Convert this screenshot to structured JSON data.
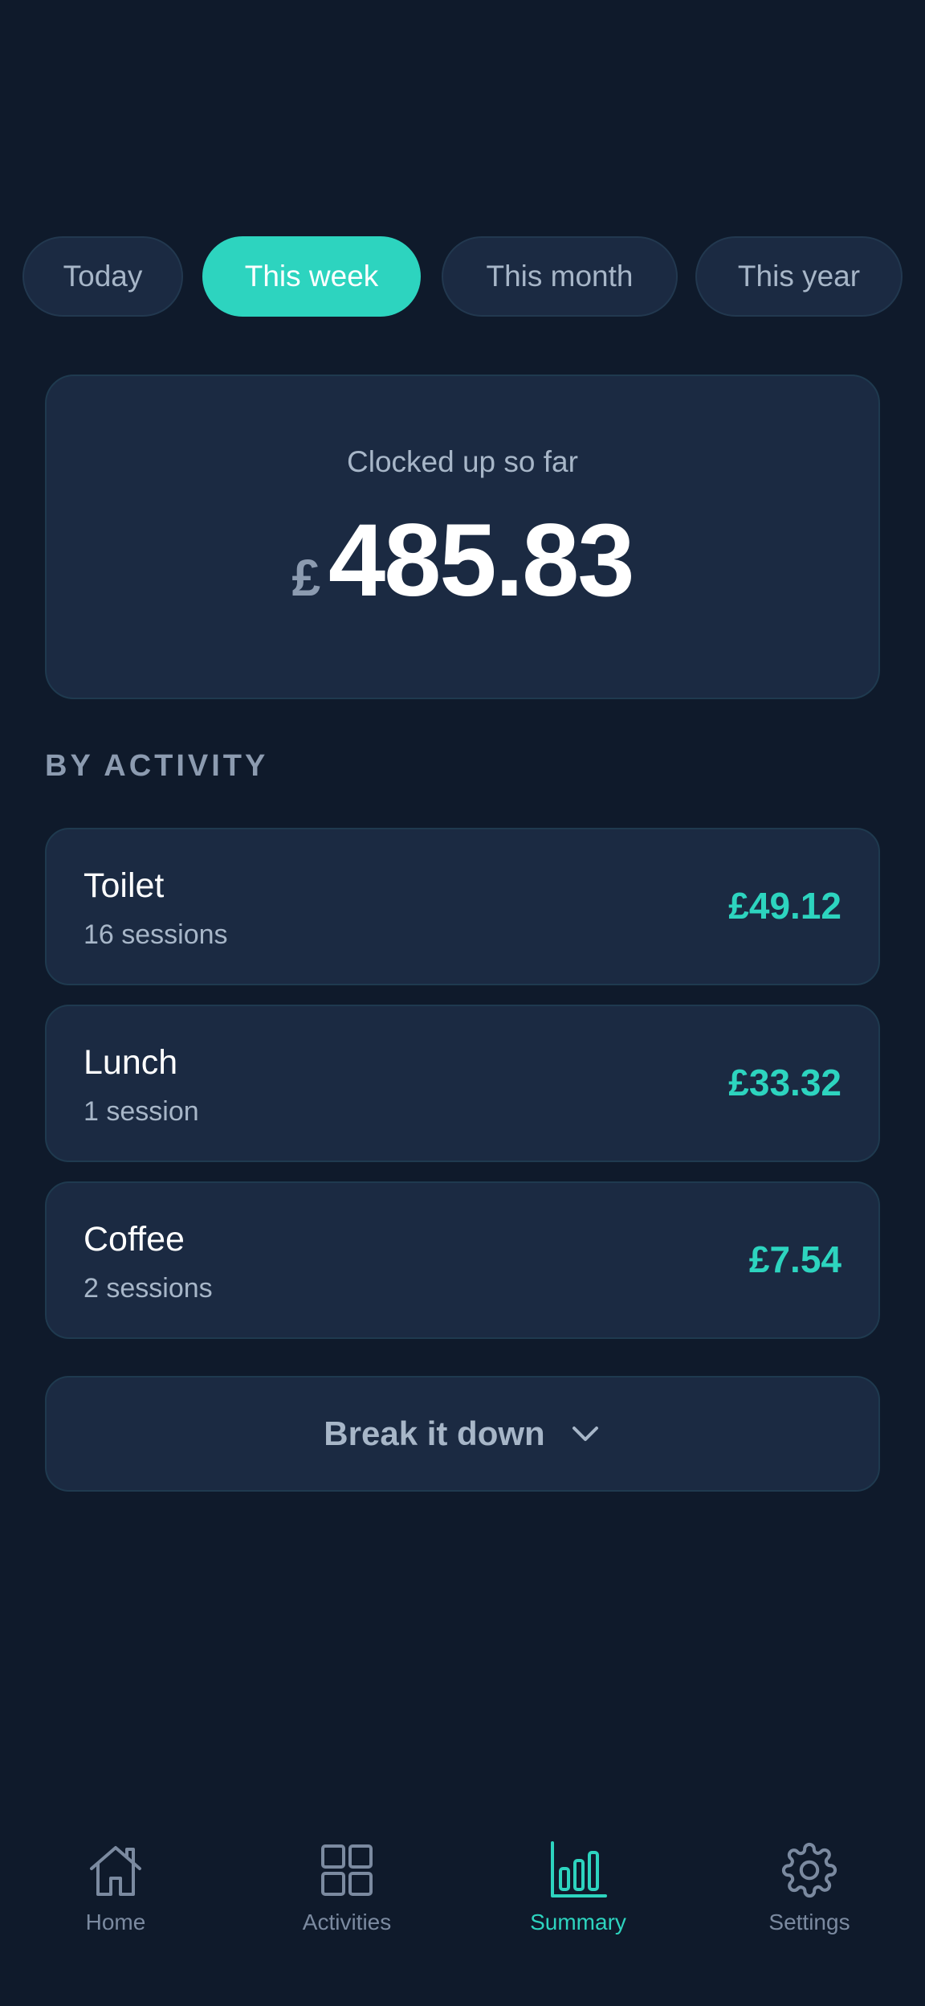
{
  "tabs": [
    {
      "label": "Today",
      "active": false
    },
    {
      "label": "This week",
      "active": true
    },
    {
      "label": "This month",
      "active": false
    },
    {
      "label": "This year",
      "active": false
    }
  ],
  "summary": {
    "label": "Clocked up so far",
    "currency": "£",
    "amount": "485.83"
  },
  "section": {
    "heading": "BY ACTIVITY"
  },
  "activities": [
    {
      "name": "Toilet",
      "sessions": "16 sessions",
      "amount": "£49.12"
    },
    {
      "name": "Lunch",
      "sessions": "1 session",
      "amount": "£33.32"
    },
    {
      "name": "Coffee",
      "sessions": "2 sessions",
      "amount": "£7.54"
    }
  ],
  "breakdown": {
    "label": "Break it down",
    "icon": "chevron-down-icon"
  },
  "nav": {
    "items": [
      {
        "label": "Home",
        "icon": "home-icon",
        "active": false
      },
      {
        "label": "Activities",
        "icon": "grid-icon",
        "active": false
      },
      {
        "label": "Summary",
        "icon": "bar-chart-icon",
        "active": true
      },
      {
        "label": "Settings",
        "icon": "gear-icon",
        "active": false
      }
    ]
  },
  "colors": {
    "background": "#0f1a2b",
    "card": "#1b2a42",
    "accent": "#2dd4bf",
    "muted_text": "#a7b6c8"
  }
}
